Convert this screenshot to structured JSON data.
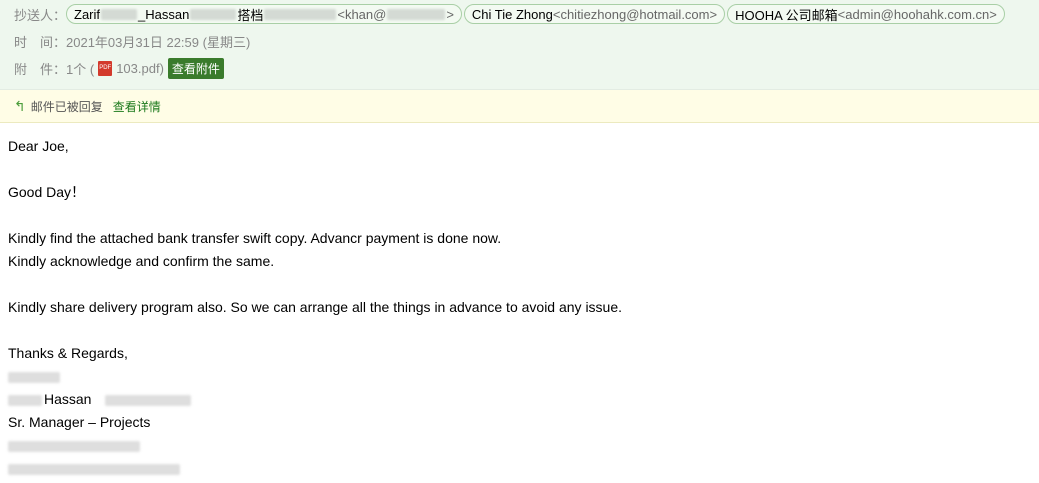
{
  "header": {
    "cc_label": "抄送人：",
    "cc_recipients": [
      {
        "name": "Zarif",
        "name2": "_Hassan",
        "name3": "搭档",
        "address_start": "<",
        "address": "khan@",
        "address_end": ">"
      },
      {
        "name": "Chi Tie Zhong",
        "address": "<chitiezhong@hotmail.com>"
      },
      {
        "name": "HOOHA 公司邮箱",
        "address": "<admin@hoohahk.com.cn>"
      }
    ],
    "time_label": "时　间：",
    "time_value": "2021年03月31日 22:59 (星期三)",
    "attach_label": "附　件：",
    "attach_count": "1个 (",
    "attach_file_icon": "PDF",
    "attach_file": "103.pdf",
    "attach_close": ")",
    "view_attachment_label": "查看附件"
  },
  "notice": {
    "icon": "reply-arrow-icon",
    "text": "邮件已被回复",
    "link": "查看详情"
  },
  "message": {
    "greeting": "Dear Joe,",
    "good_day": "Good Day！",
    "line1": "Kindly find the attached bank transfer swift copy. Advancr payment is done now.",
    "line2": "Kindly acknowledge and confirm the same.",
    "line3": "Kindly share delivery program also. So we can arrange all the things in advance to avoid any issue.",
    "closing": "Thanks & Regards,",
    "sig_name": "Hassan",
    "sig_title": "Sr. Manager – Projects"
  },
  "colors": {
    "header_bg": "#eef7ee",
    "notice_bg": "#fffde6",
    "accent_green": "#3a7b2c",
    "pdf_red": "#d33a2c"
  }
}
